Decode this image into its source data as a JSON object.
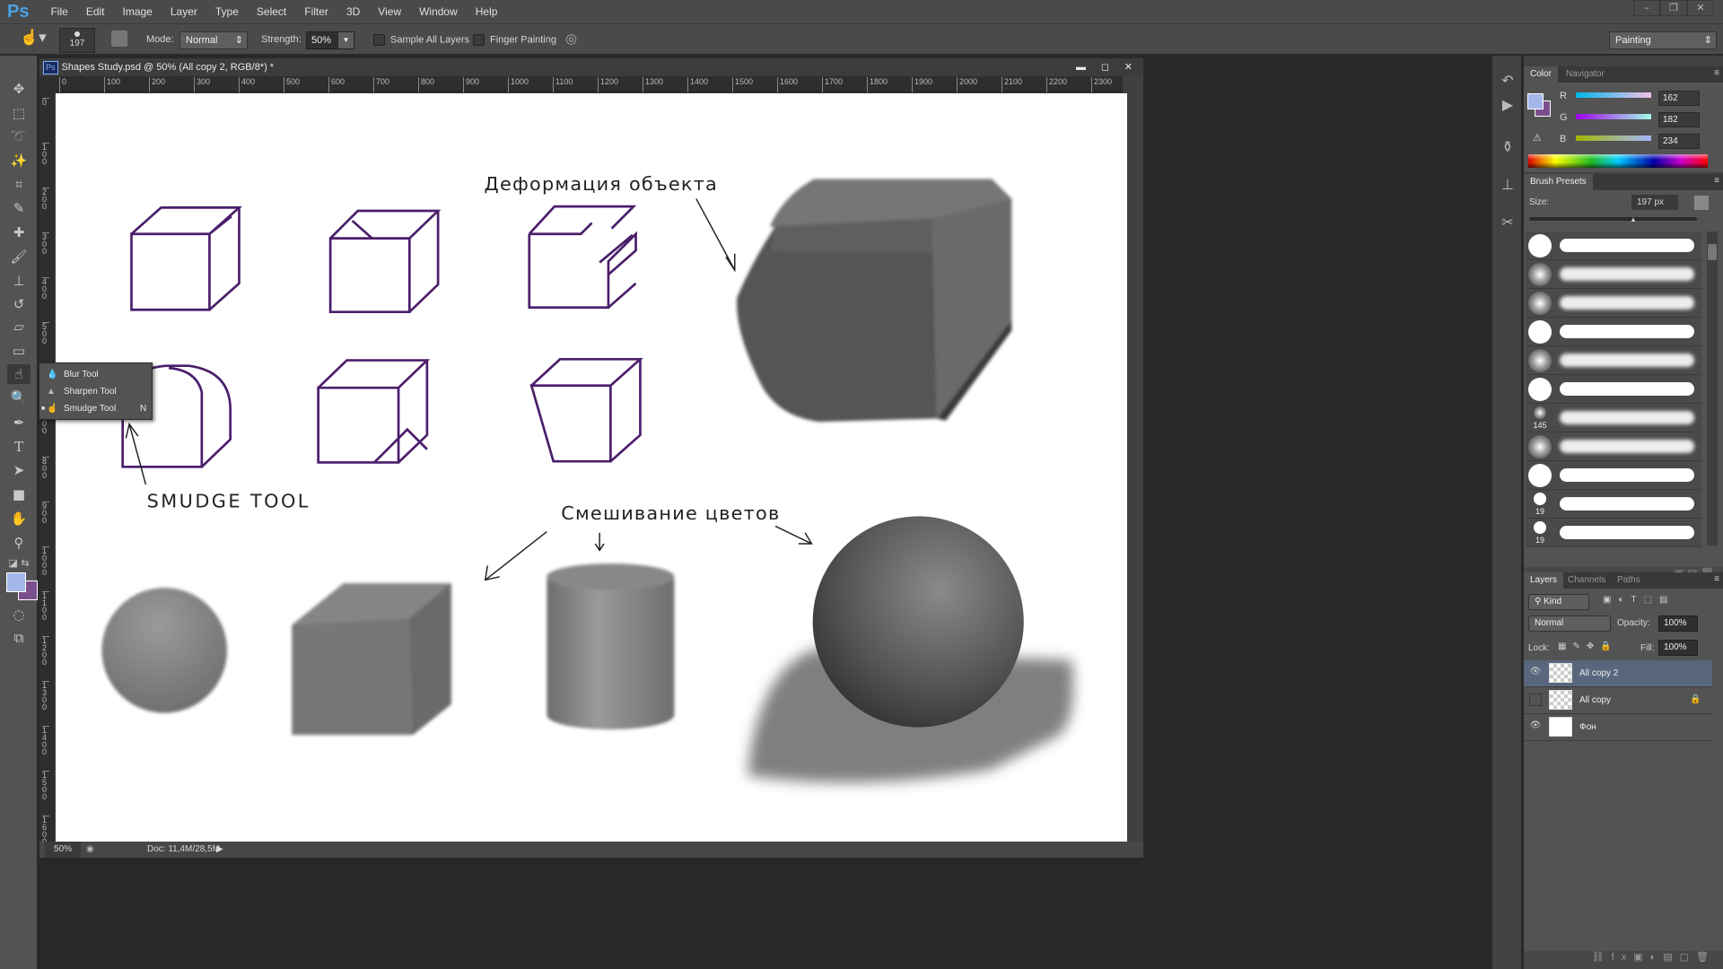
{
  "app": {
    "logo": "Ps",
    "menu": [
      "File",
      "Edit",
      "Image",
      "Layer",
      "Type",
      "Select",
      "Filter",
      "3D",
      "View",
      "Window",
      "Help"
    ],
    "window_controls": [
      "–",
      "❐",
      "✕"
    ]
  },
  "options": {
    "brush_size": "197",
    "mode_label": "Mode:",
    "mode_value": "Normal",
    "strength_label": "Strength:",
    "strength_value": "50%",
    "sample_all_layers": "Sample All Layers",
    "sample_all_checked": false,
    "finger_painting": "Finger Painting",
    "finger_checked": false,
    "workspace": "Painting"
  },
  "document": {
    "title": "Shapes Study.psd @ 50% (All copy 2, RGB/8*) *",
    "icon": "Ps",
    "zoom": "50%",
    "doc_info": "Doc: 11,4M/28,5M",
    "ruler_h": [
      "0",
      "100",
      "200",
      "300",
      "400",
      "500",
      "600",
      "700",
      "800",
      "900",
      "1000",
      "1100",
      "1200",
      "1300",
      "1400",
      "1500",
      "1600",
      "1700",
      "1800",
      "1900",
      "2000",
      "2100",
      "2200",
      "2300"
    ],
    "ruler_v": [
      "0",
      "100",
      "200",
      "300",
      "400",
      "500",
      "600",
      "700",
      "800",
      "900",
      "1000",
      "1100",
      "1200",
      "1300",
      "1400",
      "1500",
      "1600"
    ]
  },
  "canvas": {
    "annotation_deform": "Деформация объекта",
    "annotation_smudge": "SMUDGE TOOL",
    "annotation_blend": "Смешивание цветов",
    "line_color": "#4a1f6b"
  },
  "flyout": {
    "items": [
      {
        "label": "Blur Tool",
        "shortcut": ""
      },
      {
        "label": "Sharpen Tool",
        "shortcut": ""
      },
      {
        "label": "Smudge Tool",
        "shortcut": "N",
        "selected": true
      }
    ]
  },
  "colors": {
    "foreground": "#a2b6ea",
    "background": "#7a4f8e"
  },
  "color_panel": {
    "tabs": [
      "Color",
      "Navigator"
    ],
    "r_label": "R",
    "g_label": "G",
    "b_label": "B",
    "r": "162",
    "g": "182",
    "b": "234"
  },
  "brush_panel": {
    "title": "Brush Presets",
    "size_label": "Size:",
    "size_value": "197 px",
    "size_fraction": 0.62,
    "presets": [
      {
        "type": "hard",
        "label": ""
      },
      {
        "type": "soft",
        "label": ""
      },
      {
        "type": "soft",
        "label": ""
      },
      {
        "type": "hard",
        "label": ""
      },
      {
        "type": "soft",
        "label": ""
      },
      {
        "type": "hard",
        "label": ""
      },
      {
        "type": "soft-small",
        "label": "145"
      },
      {
        "type": "soft",
        "label": ""
      },
      {
        "type": "hard",
        "label": ""
      },
      {
        "type": "hard-small",
        "label": "19"
      },
      {
        "type": "hard-small",
        "label": "19"
      }
    ]
  },
  "layers_panel": {
    "tabs": [
      "Layers",
      "Channels",
      "Paths"
    ],
    "filter": "Kind",
    "blend_mode": "Normal",
    "opacity_label": "Opacity:",
    "opacity": "100%",
    "lock_label": "Lock:",
    "fill_label": "Fill:",
    "fill": "100%",
    "layers": [
      {
        "name": "All copy 2",
        "visible": true,
        "selected": true,
        "locked": false
      },
      {
        "name": "All copy",
        "visible": false,
        "selected": false,
        "locked": true
      },
      {
        "name": "Фон",
        "visible": true,
        "selected": false,
        "locked": false
      }
    ]
  }
}
